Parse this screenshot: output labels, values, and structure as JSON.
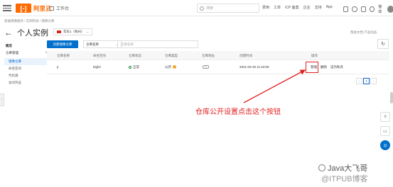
{
  "topbar": {
    "logo_mark": "[-]",
    "logo_text": "阿里云",
    "workbench": "工作台",
    "search_placeholder": "搜索",
    "links": [
      "费用",
      "工单",
      "ICP 备案",
      "企业",
      "支持",
      "App"
    ],
    "user": "猫妹"
  },
  "breadcrumb": "容器镜像服务 / 实例列表 / 镜像仓库",
  "page_title": "个人实例",
  "region": "华东1（杭州）",
  "top_right_links": "帮助文档 产品动态",
  "nav": {
    "head": "概览",
    "group": "仓库管理",
    "items": [
      "镜像仓库",
      "命名空间",
      "代码源",
      "访问凭证"
    ],
    "active": "镜像仓库"
  },
  "toolbar": {
    "create_label": "创建镜像仓库",
    "filter_select": "仓库名称",
    "filter_placeholder": "仓库名称"
  },
  "table": {
    "headers": [
      "仓库名称",
      "命名空间",
      "仓库状态",
      "仓库类型",
      "仓库地址",
      "创建时间",
      "操作"
    ],
    "rows": [
      {
        "name": "jr",
        "namespace": "bigfei",
        "status": "正常",
        "type": "公开",
        "created": "2021-03-26 11:23:50",
        "actions": [
          "管理",
          "删除",
          "设为私有"
        ]
      }
    ]
  },
  "pager": {
    "current": "1"
  },
  "annotation": "仓库公开设置点击这个按钮",
  "watermark": {
    "line1": "Java大飞哥",
    "line2": "@ITPUB博客"
  }
}
